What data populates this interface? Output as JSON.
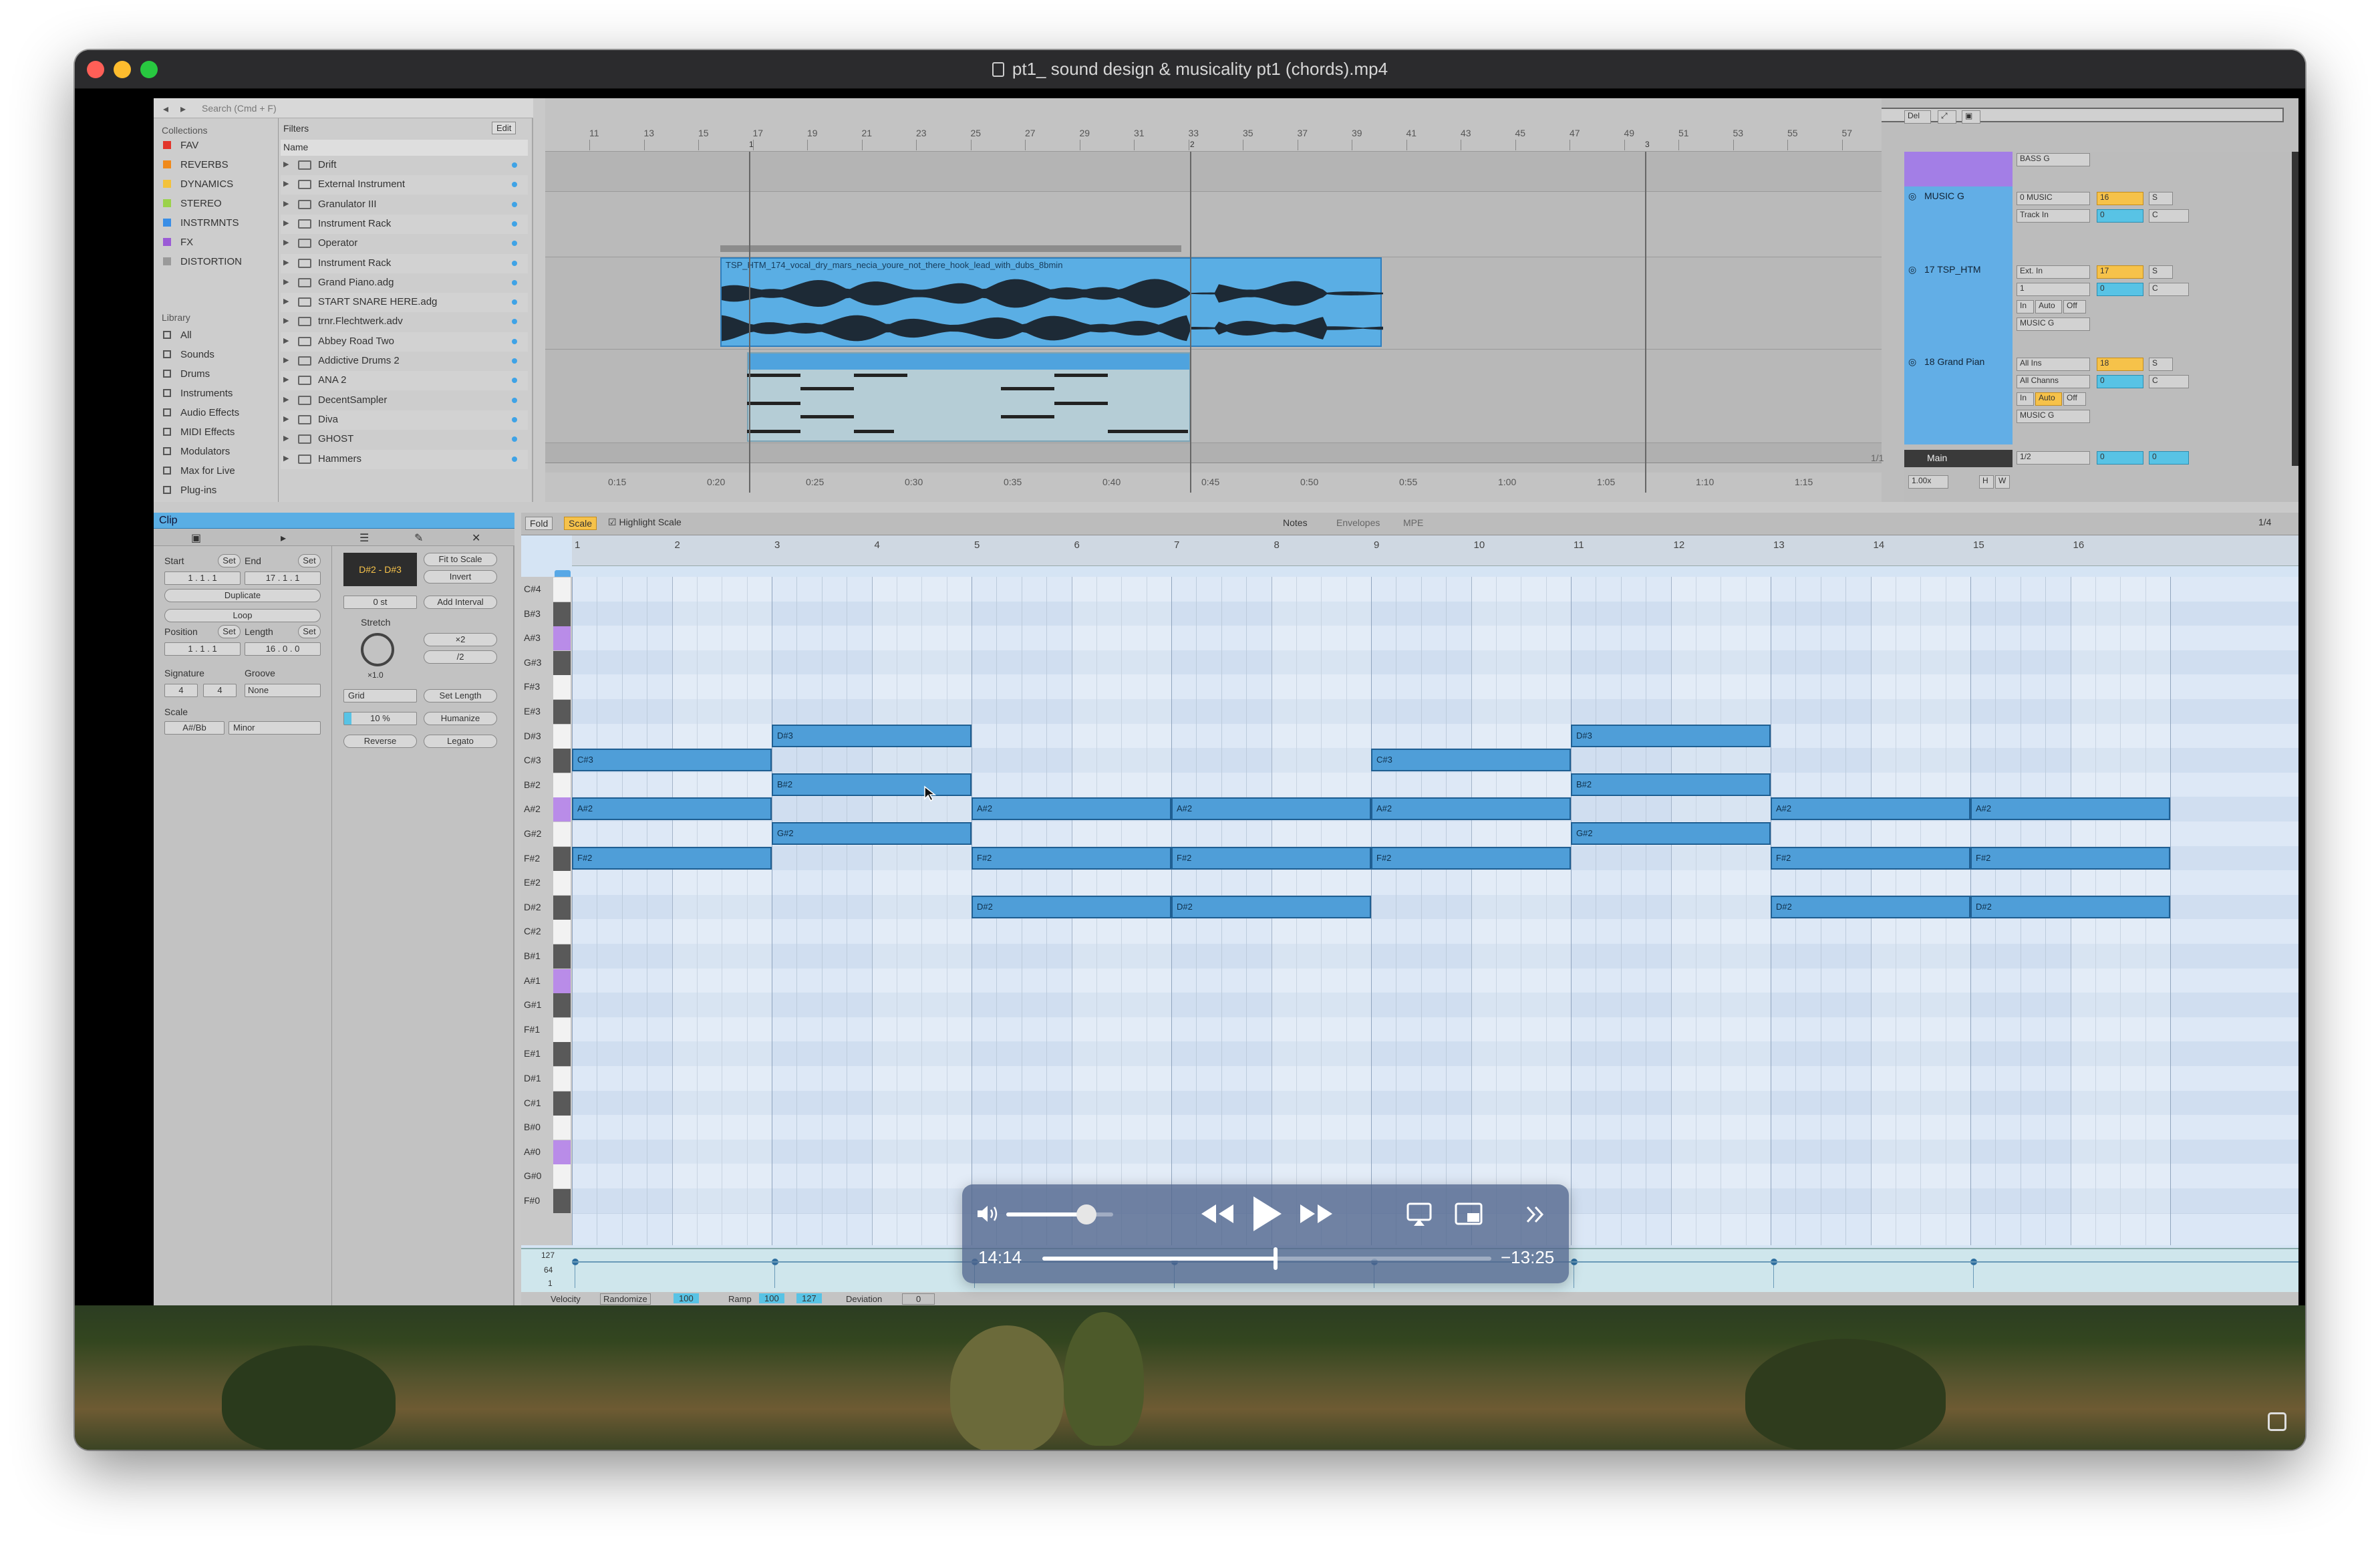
{
  "window": {
    "title": "pt1_ sound design & musicality pt1 (chords).mp4"
  },
  "browser": {
    "search_placeholder": "Search (Cmd + F)",
    "collections_label": "Collections",
    "filters_label": "Filters",
    "edit_label": "Edit",
    "name_col": "Name",
    "collections": [
      {
        "label": "FAV",
        "color": "#e2352b"
      },
      {
        "label": "REVERBS",
        "color": "#f08a1c"
      },
      {
        "label": "DYNAMICS",
        "color": "#f3c23c"
      },
      {
        "label": "STEREO",
        "color": "#9bd24b"
      },
      {
        "label": "INSTRMNTS",
        "color": "#3a8ee6"
      },
      {
        "label": "FX",
        "color": "#9b5bd6"
      },
      {
        "label": "DISTORTION",
        "color": "#9a9a9a"
      }
    ],
    "library_label": "Library",
    "library": [
      "All",
      "Sounds",
      "Drums",
      "Instruments",
      "Audio Effects",
      "MIDI Effects",
      "Modulators",
      "Max for Live",
      "Plug-ins"
    ],
    "files": [
      "Drift",
      "External Instrument",
      "Granulator III",
      "Instrument Rack",
      "Operator",
      "Instrument Rack",
      "Grand Piano.adg",
      "START SNARE HERE.adg",
      "trnr.Flechtwerk.adv",
      "Abbey Road Two",
      "Addictive Drums 2",
      "ANA 2",
      "DecentSampler",
      "Diva",
      "GHOST",
      "Hammers"
    ]
  },
  "arrangement": {
    "bar_numbers": [
      "11",
      "13",
      "15",
      "17",
      "19",
      "21",
      "23",
      "25",
      "27",
      "29",
      "31",
      "33",
      "35",
      "37",
      "39",
      "41",
      "43",
      "45",
      "47",
      "49",
      "51",
      "53",
      "55",
      "57"
    ],
    "locators": [
      "1",
      "2",
      "3"
    ],
    "time_labels": [
      "0:15",
      "0:20",
      "0:25",
      "0:30",
      "0:35",
      "0:40",
      "0:45",
      "0:50",
      "0:55",
      "1:00",
      "1:05",
      "1:10",
      "1:15"
    ],
    "audio_clip_name": "TSP_HTM_174_vocal_dry_mars_necia_youre_not_there_hook_lead_with_dubs_8bmin",
    "tracks": [
      {
        "name": "MUSIC G",
        "number": "16",
        "in": "0 MUSIC",
        "mon": "Track In",
        "vol": "0",
        "pan": "C"
      },
      {
        "name": "17 TSP_HTM",
        "number": "17",
        "in": "Ext. In",
        "ch": "1",
        "out": "MUSIC G",
        "vol": "0",
        "pan": "C"
      },
      {
        "name": "18 Grand Pian",
        "number": "18",
        "in": "All Ins",
        "ch": "All Channs",
        "out": "MUSIC G",
        "vol": "0",
        "pan": "C"
      }
    ],
    "bass_g": "BASS G",
    "main_label": "Main",
    "main_out": "1/2",
    "main_vol": "0",
    "main_pan": "0",
    "monitor": [
      "In",
      "Auto",
      "Off"
    ],
    "del_label": "Del",
    "zoom": "1.00x",
    "hw": [
      "H",
      "W"
    ],
    "page": "1/1",
    "solo": "S"
  },
  "clip": {
    "title": "Clip",
    "start_label": "Start",
    "end_label": "End",
    "set_label": "Set",
    "start": "1 . 1 . 1",
    "end": "17 . 1 . 1",
    "duplicate": "Duplicate",
    "loop": "Loop",
    "position_label": "Position",
    "length_label": "Length",
    "position": "1 . 1 . 1",
    "length": "16 . 0 . 0",
    "signature_label": "Signature",
    "groove_label": "Groove",
    "sig_num": "4",
    "sig_den": "4",
    "groove": "None",
    "scale_label": "Scale",
    "scale_root": "A#/Bb",
    "scale_mode": "Minor",
    "range": "D#2 - D#3",
    "fit_to_scale": "Fit to Scale",
    "invert": "Invert",
    "transpose": "0 st",
    "add_interval": "Add Interval",
    "stretch": "Stretch",
    "stretch_val": "×1.0",
    "mul": "×2",
    "div": "/2",
    "grid": "Grid",
    "set_length": "Set Length",
    "humanize_amt": "10 %",
    "humanize": "Humanize",
    "reverse": "Reverse",
    "legato": "Legato"
  },
  "editor": {
    "fold": "Fold",
    "scale": "Scale",
    "highlight": "Highlight Scale",
    "tabs": [
      "Notes",
      "Envelopes",
      "MPE"
    ],
    "quant": "1/4",
    "bars": [
      "1",
      "2",
      "3",
      "4",
      "5",
      "6",
      "7",
      "8",
      "9",
      "10",
      "11",
      "12",
      "13",
      "14",
      "15",
      "16"
    ],
    "pitches": [
      "C#4",
      "B#3",
      "A#3",
      "G#3",
      "F#3",
      "E#3",
      "D#3",
      "C#3",
      "B#2",
      "A#2",
      "G#2",
      "F#2",
      "E#2",
      "D#2",
      "C#2",
      "B#1",
      "A#1",
      "G#1",
      "F#1",
      "E#1",
      "D#1",
      "C#1",
      "B#0",
      "A#0",
      "G#0",
      "F#0"
    ],
    "notes": [
      {
        "pitch": 7,
        "start": 0,
        "len": 2,
        "label": "C#3"
      },
      {
        "pitch": 9,
        "start": 0,
        "len": 2,
        "label": "A#2"
      },
      {
        "pitch": 11,
        "start": 0,
        "len": 2,
        "label": "F#2"
      },
      {
        "pitch": 6,
        "start": 2,
        "len": 2,
        "label": "D#3"
      },
      {
        "pitch": 8,
        "start": 2,
        "len": 2,
        "label": "B#2"
      },
      {
        "pitch": 10,
        "start": 2,
        "len": 2,
        "label": "G#2"
      },
      {
        "pitch": 9,
        "start": 4,
        "len": 2,
        "label": "A#2"
      },
      {
        "pitch": 11,
        "start": 4,
        "len": 2,
        "label": "F#2"
      },
      {
        "pitch": 13,
        "start": 4,
        "len": 2,
        "label": "D#2"
      },
      {
        "pitch": 9,
        "start": 6,
        "len": 2,
        "label": "A#2"
      },
      {
        "pitch": 11,
        "start": 6,
        "len": 2,
        "label": "F#2"
      },
      {
        "pitch": 13,
        "start": 6,
        "len": 2,
        "label": "D#2"
      },
      {
        "pitch": 7,
        "start": 8,
        "len": 2,
        "label": "C#3"
      },
      {
        "pitch": 9,
        "start": 8,
        "len": 2,
        "label": "A#2"
      },
      {
        "pitch": 11,
        "start": 8,
        "len": 2,
        "label": "F#2"
      },
      {
        "pitch": 6,
        "start": 10,
        "len": 2,
        "label": "D#3"
      },
      {
        "pitch": 8,
        "start": 10,
        "len": 2,
        "label": "B#2"
      },
      {
        "pitch": 10,
        "start": 10,
        "len": 2,
        "label": "G#2"
      },
      {
        "pitch": 9,
        "start": 12,
        "len": 2,
        "label": "A#2"
      },
      {
        "pitch": 11,
        "start": 12,
        "len": 2,
        "label": "F#2"
      },
      {
        "pitch": 13,
        "start": 12,
        "len": 2,
        "label": "D#2"
      },
      {
        "pitch": 9,
        "start": 14,
        "len": 2,
        "label": "A#2"
      },
      {
        "pitch": 11,
        "start": 14,
        "len": 2,
        "label": "F#2"
      },
      {
        "pitch": 13,
        "start": 14,
        "len": 2,
        "label": "D#2"
      }
    ],
    "velocity": {
      "label": "Velocity",
      "randomize": "Randomize",
      "value": "100",
      "ramp": "Ramp",
      "ramp_from": "100",
      "ramp_to": "127",
      "deviation": "Deviation",
      "deviation_val": "0",
      "max": "127",
      "mid": "64",
      "min": "1"
    }
  },
  "player": {
    "elapsed": "14:14",
    "remaining": "−13:25",
    "progress": 0.52,
    "volume": 0.75
  }
}
